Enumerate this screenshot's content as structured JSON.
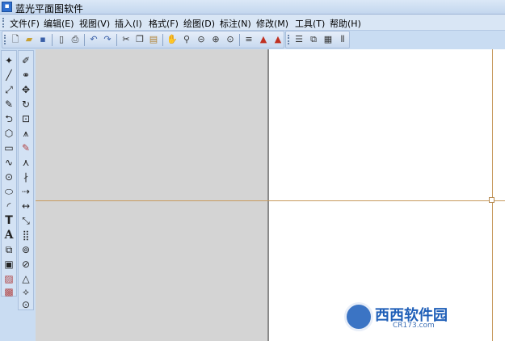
{
  "window": {
    "title": "蓝光平面图软件"
  },
  "menu": [
    {
      "id": "file",
      "label": "文件(F)"
    },
    {
      "id": "edit",
      "label": "编辑(E)"
    },
    {
      "id": "view",
      "label": "视图(V)"
    },
    {
      "id": "insert",
      "label": "插入(I)"
    },
    {
      "id": "format",
      "label": "格式(F)"
    },
    {
      "id": "draw",
      "label": "绘图(D)"
    },
    {
      "id": "dimension",
      "label": "标注(N)"
    },
    {
      "id": "modify",
      "label": "修改(M)"
    },
    {
      "id": "tools",
      "label": "工具(T)"
    },
    {
      "id": "help",
      "label": "帮助(H)"
    }
  ],
  "icons": {
    "main_toolbar": [
      "new-file-icon",
      "open-folder-icon",
      "save-icon",
      "print-preview-icon",
      "print-icon",
      "undo-icon",
      "redo-icon",
      "cut-icon",
      "copy-icon",
      "paste-icon",
      "pan-icon",
      "zoom-realtime-icon",
      "zoom-previous-icon",
      "zoom-window-icon",
      "zoom-extents-icon",
      "line-weight-icon",
      "layer-red-icon",
      "layer-red-alt-icon"
    ],
    "extra_toolbar": [
      "layer-manager-icon",
      "layer-state-icon",
      "hatch-lines-icon",
      "vertical-bars-icon"
    ],
    "draw_toolbar": [
      "point-icon",
      "line-icon",
      "ray-icon",
      "eraser-icon",
      "polyline-icon",
      "polygon-icon",
      "rectangle-icon",
      "spline-icon",
      "circle-icon",
      "ellipse-icon",
      "arc-icon",
      "text-icon",
      "multiline-text-icon",
      "block-insert-icon",
      "block-make-icon",
      "image-icon",
      "hatch-icon"
    ],
    "modify_toolbar": [
      "pencil-icon",
      "copy-object-icon",
      "move-icon",
      "rotate-icon",
      "scale-icon",
      "mirror-icon",
      "brush-icon",
      "stretch-icon",
      "trim-icon",
      "extend-icon",
      "dimension-linear-icon",
      "dimension-aligned-icon",
      "array-icon",
      "offset-icon",
      "chamfer-icon",
      "fillet-icon",
      "explode-icon",
      "snap-point-icon"
    ]
  },
  "watermark": {
    "brand": "西西软件园",
    "site": "CR173.com"
  },
  "colors": {
    "accent_line": "#c79a5e",
    "gray_area": "#d4d4d4",
    "chrome": "#c9dcf2"
  }
}
